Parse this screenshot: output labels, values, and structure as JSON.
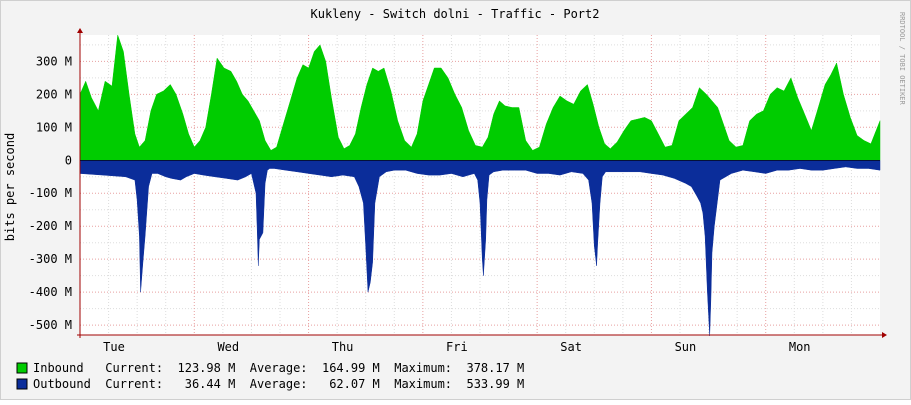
{
  "chart_data": {
    "type": "area",
    "title": "Kukleny - Switch dolni - Traffic - Port2",
    "ylabel": "bits per second",
    "watermark": "RRDTOOL / TOBI OETIKER",
    "ylim": [
      -530,
      380
    ],
    "y_unit_scale": "M",
    "yticks": [
      {
        "value": 300,
        "label": "300 M"
      },
      {
        "value": 200,
        "label": "200 M"
      },
      {
        "value": 100,
        "label": "100 M"
      },
      {
        "value": 0,
        "label": "0"
      },
      {
        "value": -100,
        "label": "-100 M"
      },
      {
        "value": -200,
        "label": "-200 M"
      },
      {
        "value": -300,
        "label": "-300 M"
      },
      {
        "value": -400,
        "label": "-400 M"
      },
      {
        "value": -500,
        "label": "-500 M"
      }
    ],
    "xlim": [
      0,
      7
    ],
    "xticks": [
      {
        "day": 0,
        "label": "Tue"
      },
      {
        "day": 1,
        "label": "Wed"
      },
      {
        "day": 2,
        "label": "Thu"
      },
      {
        "day": 3,
        "label": "Fri"
      },
      {
        "day": 4,
        "label": "Sat"
      },
      {
        "day": 5,
        "label": "Sun"
      },
      {
        "day": 6,
        "label": "Mon"
      }
    ],
    "grid": true,
    "colors": {
      "background": "#f3f3f3",
      "plot": "#ffffff",
      "inbound": "#00cc00",
      "outbound": "#0b2d9a",
      "grid_major": "#e8a0a0",
      "grid_minor": "#dddddd",
      "axis": "#a00000"
    },
    "series": [
      {
        "name": "Inbound",
        "color": "#00cc00",
        "x_days": [
          0,
          0.05,
          0.1,
          0.16,
          0.22,
          0.28,
          0.33,
          0.38,
          0.43,
          0.48,
          0.52,
          0.57,
          0.62,
          0.67,
          0.73,
          0.79,
          0.84,
          0.9,
          0.95,
          1.0,
          1.05,
          1.1,
          1.15,
          1.2,
          1.26,
          1.32,
          1.37,
          1.42,
          1.47,
          1.52,
          1.57,
          1.62,
          1.67,
          1.72,
          1.78,
          1.84,
          1.9,
          1.95,
          2.0,
          2.05,
          2.1,
          2.15,
          2.2,
          2.26,
          2.31,
          2.36,
          2.41,
          2.46,
          2.51,
          2.56,
          2.61,
          2.66,
          2.72,
          2.78,
          2.84,
          2.9,
          2.95,
          3.0,
          3.05,
          3.1,
          3.16,
          3.22,
          3.28,
          3.34,
          3.4,
          3.46,
          3.52,
          3.57,
          3.62,
          3.67,
          3.72,
          3.78,
          3.84,
          3.9,
          3.96,
          4.02,
          4.08,
          4.14,
          4.2,
          4.26,
          4.32,
          4.38,
          4.44,
          4.49,
          4.54,
          4.59,
          4.64,
          4.7,
          4.76,
          4.82,
          4.88,
          4.94,
          5.0,
          5.06,
          5.12,
          5.18,
          5.24,
          5.3,
          5.36,
          5.42,
          5.48,
          5.53,
          5.58,
          5.63,
          5.68,
          5.74,
          5.8,
          5.86,
          5.92,
          5.98,
          6.04,
          6.1,
          6.16,
          6.22,
          6.28,
          6.34,
          6.4,
          6.46,
          6.52,
          6.57,
          6.62,
          6.68,
          6.74,
          6.8,
          6.86,
          6.92,
          7.0
        ],
        "values": [
          200,
          240,
          190,
          150,
          240,
          225,
          380,
          330,
          200,
          80,
          40,
          60,
          150,
          200,
          210,
          230,
          200,
          140,
          80,
          40,
          60,
          100,
          200,
          310,
          280,
          270,
          240,
          200,
          180,
          150,
          120,
          60,
          30,
          40,
          110,
          180,
          250,
          290,
          280,
          330,
          350,
          300,
          190,
          70,
          35,
          45,
          80,
          160,
          230,
          280,
          270,
          280,
          210,
          120,
          60,
          40,
          80,
          180,
          230,
          280,
          280,
          250,
          200,
          160,
          90,
          45,
          40,
          70,
          140,
          180,
          165,
          160,
          160,
          60,
          30,
          40,
          110,
          160,
          195,
          180,
          170,
          210,
          230,
          170,
          100,
          50,
          35,
          55,
          90,
          120,
          125,
          130,
          120,
          80,
          40,
          45,
          120,
          140,
          160,
          220,
          200,
          180,
          160,
          110,
          60,
          40,
          45,
          120,
          140,
          150,
          200,
          220,
          210,
          250,
          190,
          140,
          90,
          160,
          230,
          260,
          295,
          200,
          130,
          75,
          60,
          50,
          120
        ]
      },
      {
        "name": "Outbound",
        "color": "#0b2d9a",
        "x_days": [
          0,
          0.2,
          0.4,
          0.48,
          0.5,
          0.52,
          0.53,
          0.55,
          0.57,
          0.6,
          0.63,
          0.68,
          0.75,
          0.8,
          0.88,
          0.93,
          1.0,
          1.08,
          1.18,
          1.28,
          1.38,
          1.45,
          1.5,
          1.54,
          1.55,
          1.56,
          1.57,
          1.6,
          1.62,
          1.64,
          1.66,
          1.7,
          1.8,
          1.9,
          2.0,
          2.1,
          2.2,
          2.3,
          2.4,
          2.44,
          2.48,
          2.5,
          2.52,
          2.54,
          2.56,
          2.58,
          2.62,
          2.68,
          2.75,
          2.85,
          2.95,
          3.05,
          3.15,
          3.25,
          3.35,
          3.45,
          3.48,
          3.5,
          3.52,
          3.53,
          3.55,
          3.56,
          3.58,
          3.62,
          3.7,
          3.8,
          3.9,
          4.0,
          4.1,
          4.2,
          4.3,
          4.4,
          4.45,
          4.48,
          4.5,
          4.52,
          4.53,
          4.55,
          4.57,
          4.6,
          4.7,
          4.8,
          4.9,
          5.0,
          5.1,
          5.2,
          5.3,
          5.35,
          5.4,
          5.43,
          5.45,
          5.47,
          5.49,
          5.51,
          5.52,
          5.53,
          5.55,
          5.6,
          5.7,
          5.8,
          5.9,
          6.0,
          6.1,
          6.2,
          6.3,
          6.4,
          6.5,
          6.6,
          6.7,
          6.8,
          6.9,
          7.0
        ],
        "values": [
          -40,
          -45,
          -50,
          -60,
          -120,
          -230,
          -400,
          -310,
          -230,
          -80,
          -40,
          -40,
          -50,
          -55,
          -60,
          -50,
          -40,
          -45,
          -50,
          -55,
          -60,
          -50,
          -40,
          -100,
          -200,
          -320,
          -240,
          -220,
          -70,
          -30,
          -25,
          -25,
          -30,
          -35,
          -40,
          -45,
          -50,
          -45,
          -50,
          -80,
          -130,
          -260,
          -400,
          -370,
          -310,
          -130,
          -50,
          -35,
          -30,
          -30,
          -40,
          -45,
          -45,
          -40,
          -50,
          -40,
          -60,
          -130,
          -300,
          -350,
          -240,
          -120,
          -45,
          -35,
          -30,
          -30,
          -30,
          -40,
          -40,
          -45,
          -35,
          -40,
          -60,
          -130,
          -260,
          -320,
          -250,
          -130,
          -50,
          -35,
          -35,
          -35,
          -35,
          -40,
          -45,
          -55,
          -70,
          -80,
          -110,
          -130,
          -160,
          -230,
          -400,
          -533,
          -420,
          -280,
          -200,
          -60,
          -40,
          -30,
          -35,
          -40,
          -30,
          -30,
          -25,
          -30,
          -30,
          -25,
          -20,
          -25,
          -25,
          -30
        ]
      }
    ],
    "legend": [
      {
        "name": "Inbound",
        "color": "#00cc00",
        "line": "Inbound   Current:  123.98 M  Average:  164.99 M  Maximum:  378.17 M",
        "current": 123.98,
        "average": 164.99,
        "maximum": 378.17
      },
      {
        "name": "Outbound",
        "color": "#0b2d9a",
        "line": "Outbound  Current:   36.44 M  Average:   62.07 M  Maximum:  533.99 M",
        "current": 36.44,
        "average": 62.07,
        "maximum": 533.99
      }
    ]
  }
}
